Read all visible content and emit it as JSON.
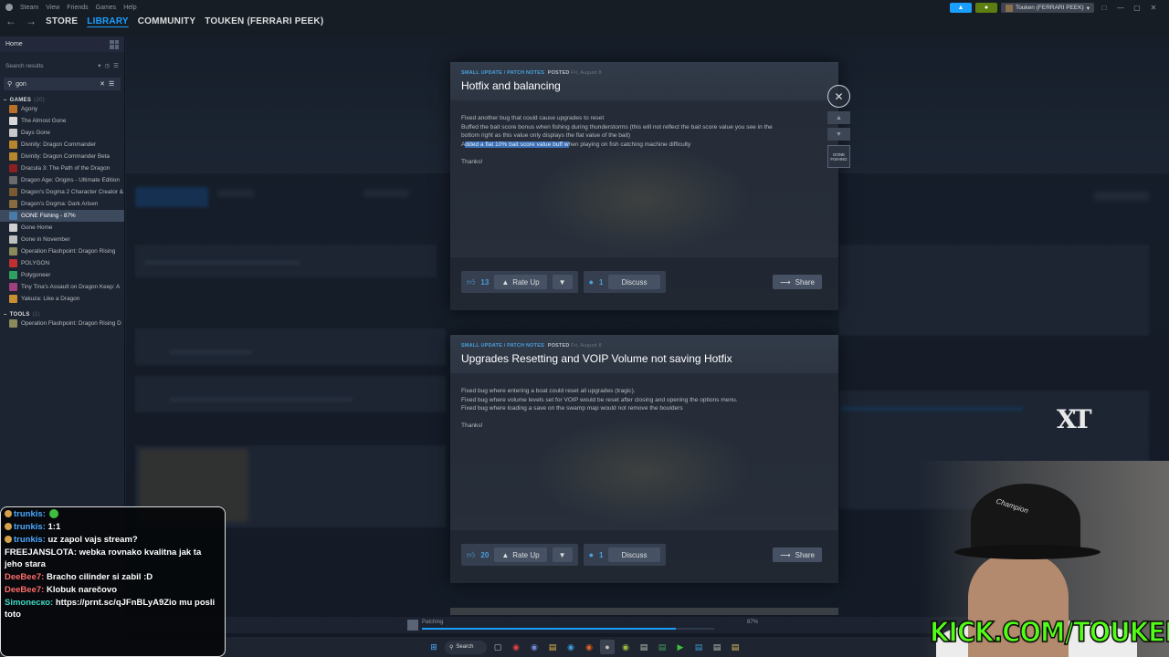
{
  "titlebar": {
    "menu": [
      "Steam",
      "View",
      "Friends",
      "Games",
      "Help"
    ],
    "nav": [
      "STORE",
      "LIBRARY",
      "COMMUNITY",
      "TOUKEN (FERRARI PEEK)"
    ],
    "active_nav": "LIBRARY",
    "user": "Touken (FERRARI PEEK)",
    "win_controls": [
      "□",
      "—",
      "▢",
      "✕"
    ]
  },
  "sidebar": {
    "home": "Home",
    "search_results": "Search results",
    "search_value": "gon",
    "games_label": "GAMES",
    "games_count": "(20)",
    "games": [
      {
        "name": "Agony",
        "color": "#b8702a"
      },
      {
        "name": "The Almost Gone",
        "color": "#d8d8d8"
      },
      {
        "name": "Days Gone",
        "color": "#c9c9c9"
      },
      {
        "name": "Divinity: Dragon Commander",
        "color": "#b8862e"
      },
      {
        "name": "Divinity: Dragon Commander Beta",
        "color": "#b8862e"
      },
      {
        "name": "Dracula 3: The Path of the Dragon",
        "color": "#8a2020"
      },
      {
        "name": "Dragon Age: Origins - Ultimate Edition",
        "color": "#6a6a6a"
      },
      {
        "name": "Dragon's Dogma 2 Character Creator & S",
        "color": "#7a5a30"
      },
      {
        "name": "Dragon's Dogma: Dark Arisen",
        "color": "#8a6a40"
      },
      {
        "name": "GONE Fishing - 87%",
        "color": "#4a7aa8",
        "selected": true
      },
      {
        "name": "Gone Home",
        "color": "#d0d0d0"
      },
      {
        "name": "Gone in November",
        "color": "#c0c0c0"
      },
      {
        "name": "Operation Flashpoint: Dragon Rising",
        "color": "#8a8a5a"
      },
      {
        "name": "POLYGON",
        "color": "#c03030"
      },
      {
        "name": "Polygoneer",
        "color": "#30a060"
      },
      {
        "name": "Tiny Tina's Assault on Dragon Keep: A",
        "color": "#a04080"
      },
      {
        "name": "Yakuza: Like a Dragon",
        "color": "#c89030"
      }
    ],
    "tools_label": "TOOLS",
    "tools_count": "(1)",
    "tools": [
      {
        "name": "Operation Flashpoint: Dragon Rising D",
        "color": "#8a8a5a"
      }
    ]
  },
  "notes": [
    {
      "tag": "SMALL UPDATE / PATCH NOTES",
      "posted": "POSTED",
      "date": "Fri, August 8",
      "title": "Hotfix and balancing",
      "line1": "Fixed another bug that could cause upgrades to reset",
      "line2": "Buffed the bait score bonus when fishing during thunderstorms (this will not reflect the bait score value you see in the",
      "line3": "bottom right as this value only displays the flat value of the bait)",
      "line4_pre": "A",
      "line4_hl": "dded a flat 10% bait score value buff w",
      "line4_post": "hen playing on fish catching machine difficulty",
      "thanks": "Thanks!",
      "likes": "13",
      "rate": "Rate Up",
      "comments": "1",
      "discuss": "Discuss",
      "share": "Share"
    },
    {
      "tag": "SMALL UPDATE / PATCH NOTES",
      "posted": "POSTED",
      "date": "Fri, August 8",
      "title": "Upgrades Resetting and VOIP Volume not saving Hotfix",
      "line1": "Fixed bug where entering a boat could reset all upgrades (tragic).",
      "line2": "Fixed bug where volume levels set for VOIP would be reset after closing and opening the options menu.",
      "line3": "Fixed bug where loading a save on the swamp map would not remove the boulders",
      "thanks": "Thanks!",
      "likes": "20",
      "rate": "Rate Up",
      "comments": "1",
      "discuss": "Discuss",
      "share": "Share"
    }
  ],
  "side_thumb_label": "GONE FISHING",
  "download": {
    "label": "Patching",
    "percent_text": "87%",
    "progress": 0.87
  },
  "taskbar": {
    "search": "Search"
  },
  "chat": [
    {
      "user": "trunkis",
      "sep": ":",
      "text": "",
      "color": "u-blue",
      "badge": true,
      "emote": true
    },
    {
      "user": "trunkis",
      "sep": ":",
      "text": " 1:1",
      "color": "u-blue",
      "badge": true
    },
    {
      "user": "trunkis",
      "sep": ":",
      "text": " uz zapol vajs stream?",
      "color": "u-blue",
      "badge": true
    },
    {
      "user": "FREEJANSLOTA",
      "sep": ":",
      "text": " webka rovnako kvalitna jak ta jeho stara",
      "color": "u-white"
    },
    {
      "user": "DeeBee7",
      "sep": ":",
      "text": " Bracho cilinder si zabil :D",
      "color": "u-red"
    },
    {
      "user": "DeeBee7",
      "sep": ":",
      "text": " Klobuk narečovo",
      "color": "u-red"
    },
    {
      "user": "Simoneско",
      "sep": ":",
      "text": " https://prnt.sc/qJFnBLyA9Zio mu posli toto",
      "color": "u-teal"
    }
  ],
  "overlay": {
    "watermark": "XT",
    "kick": "KICK.COM/TOUKEN",
    "cap_logo": "Champion"
  }
}
